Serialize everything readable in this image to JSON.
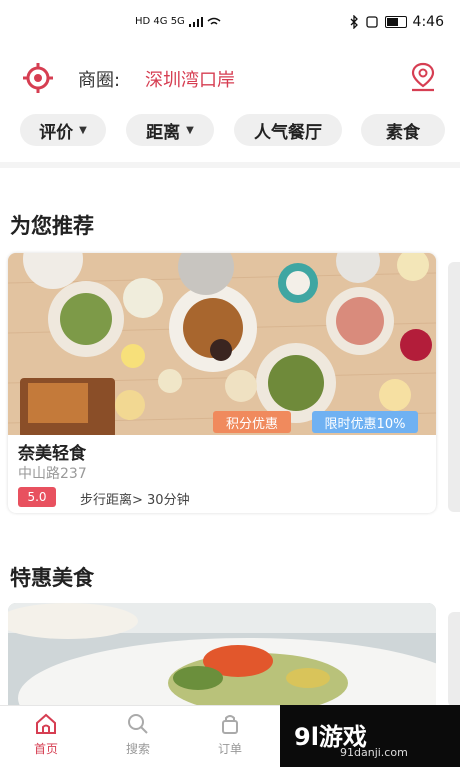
{
  "status_bar": {
    "time": "4:46",
    "left_text": "HD 4G 5G"
  },
  "header": {
    "business_label": "商圈:",
    "business_value": "深圳湾口岸"
  },
  "filters": [
    {
      "label": "评价",
      "has_arrow": true
    },
    {
      "label": "距离",
      "has_arrow": true
    },
    {
      "label": "人气餐厅",
      "has_arrow": false
    },
    {
      "label": "素食",
      "has_arrow": false
    }
  ],
  "recommend": {
    "title": "为您推荐",
    "card": {
      "name": "奈美轻食",
      "address": "中山路237",
      "rating": "5.0",
      "walk": "步行距离> 30分钟",
      "tag_points": "积分优惠",
      "tag_limited": "限时优惠10%"
    }
  },
  "special": {
    "title": "特惠美食"
  },
  "tabs": [
    {
      "label": "首页",
      "icon": "home-icon",
      "active": true
    },
    {
      "label": "搜索",
      "icon": "search-icon",
      "active": false
    },
    {
      "label": "订单",
      "icon": "order-icon",
      "active": false
    }
  ],
  "brand": {
    "title": "9l游戏",
    "subtitle": "91danji.com"
  },
  "colors": {
    "accent": "#d63e52",
    "tag_orange": "#f08a5d",
    "tag_blue": "#6fb1f2"
  }
}
